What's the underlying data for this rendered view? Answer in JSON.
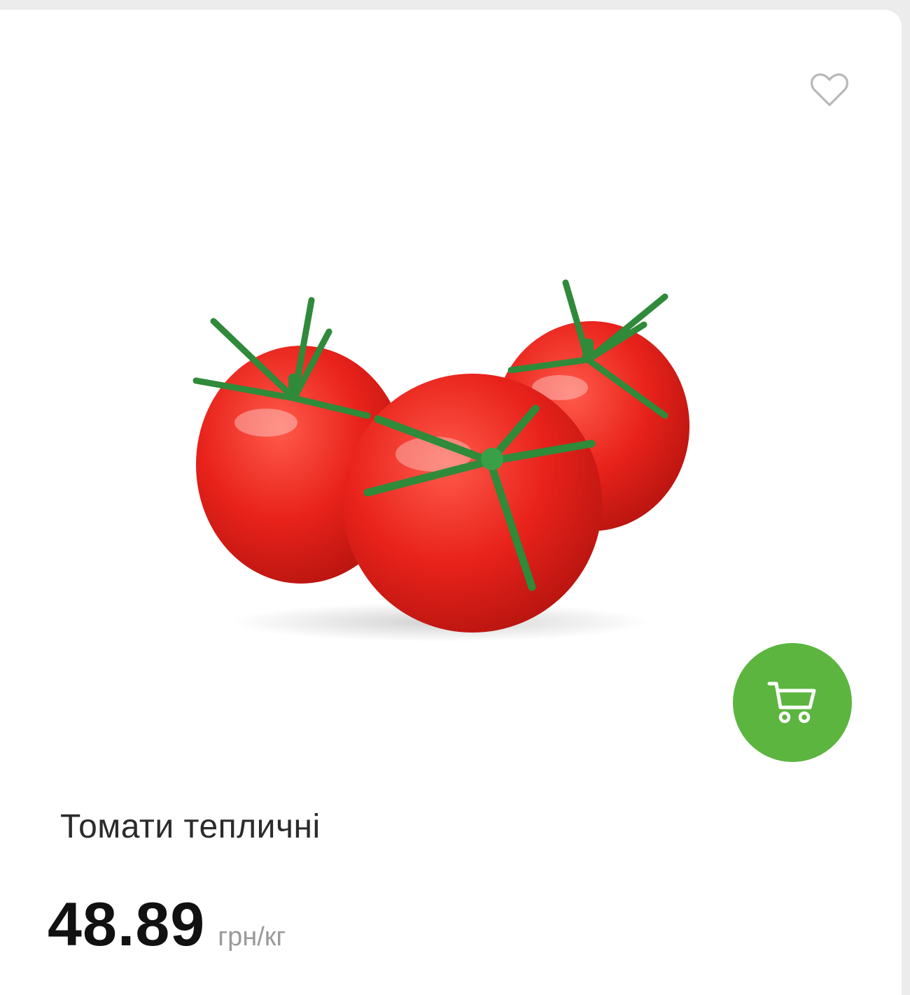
{
  "product": {
    "title": "Томати тепличні",
    "price": "48.89",
    "unit": "грн/кг",
    "image": "tomatoes-photo"
  },
  "actions": {
    "favorite_icon": "heart-outline-icon",
    "cart_icon": "shopping-cart-icon"
  },
  "colors": {
    "accent": "#5bb53f",
    "tomato": "#e8221b",
    "leaf": "#2f8a3a",
    "price": "#111111",
    "unit": "#9a9a9a",
    "icon": "#b8b8b8"
  }
}
